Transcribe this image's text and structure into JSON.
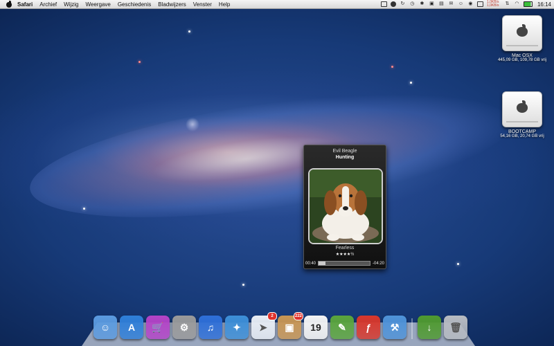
{
  "menubar": {
    "app_name": "Safari",
    "items": [
      "Archief",
      "Wijzig",
      "Weergave",
      "Geschiedenis",
      "Bladwijzers",
      "Venster",
      "Help"
    ],
    "net_up": "1,0KB/s",
    "net_down": "1,0KB/s",
    "clock": "16:14",
    "tray_icons": [
      "terminal-icon",
      "evernote-icon",
      "sync-icon",
      "time-machine-icon",
      "bluetooth-icon",
      "lock-icon",
      "calendar-icon",
      "mail-icon",
      "adium-icon",
      "status-icon",
      "display-icon",
      "speed-icon",
      "network-icon",
      "wifi-icon",
      "battery-icon"
    ]
  },
  "drives": [
    {
      "name": "Mac OSX",
      "info": "445,09 GB, 109,78 GB vrij"
    },
    {
      "name": "BOOTCAMP",
      "info": "54,16 GB, 20,74 GB vrij"
    }
  ],
  "player": {
    "artist": "Evil Beagle",
    "title": "Hunting",
    "album": "Fearless",
    "rating_text": "★★★★½",
    "elapsed": "00:40",
    "remaining": "-04:20",
    "progress": 0.13
  },
  "dock": {
    "apps": [
      {
        "name": "finder-icon",
        "color": "#5b9be0"
      },
      {
        "name": "app-store-icon",
        "color": "#2f7fd9"
      },
      {
        "name": "shop-icon",
        "color": "#b443c7"
      },
      {
        "name": "system-preferences-icon",
        "color": "#9a9a9a"
      },
      {
        "name": "itunes-icon",
        "color": "#2e6fd8"
      },
      {
        "name": "safari-icon",
        "color": "#3d8fd8"
      },
      {
        "name": "sparrow-icon",
        "color": "#e9eef5",
        "badge": "2"
      },
      {
        "name": "package-icon",
        "color": "#c99653",
        "badge": "222"
      },
      {
        "name": "calendar-icon",
        "color": "#f5f5f5",
        "label": "19"
      },
      {
        "name": "evernote-icon",
        "color": "#5aa53c"
      },
      {
        "name": "flash-icon",
        "color": "#d9372b"
      },
      {
        "name": "xcode-icon",
        "color": "#4f93d9"
      }
    ],
    "right": [
      {
        "name": "downloads-icon",
        "color": "#4f9a2f"
      },
      {
        "name": "trash-icon",
        "color": "#b8bcc2"
      }
    ]
  }
}
